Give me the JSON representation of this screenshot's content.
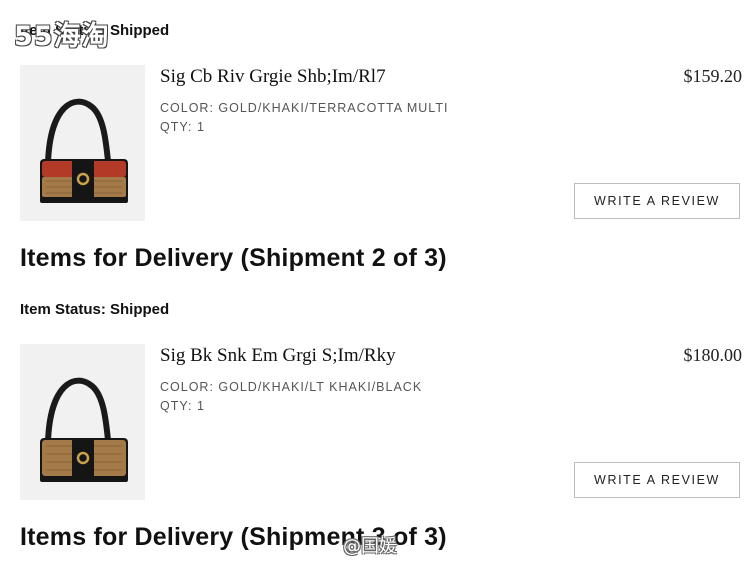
{
  "watermark_top": "55海淘",
  "watermark_bottom": "@国媛",
  "shipment1": {
    "status": "Item Status: Shipped",
    "item": {
      "name": "Sig Cb Riv Grgie Shb;Im/Rl7",
      "price": "$159.20",
      "color": "COLOR: GOLD/KHAKI/TERRACOTTA MULTI",
      "qty": "QTY: 1",
      "review_label": "WRITE A REVIEW",
      "image_icon": "handbag-terracotta"
    }
  },
  "shipment2": {
    "heading": "Items for Delivery (Shipment 2 of 3)",
    "status": "Item Status: Shipped",
    "item": {
      "name": "Sig Bk Snk Em Grgi S;Im/Rky",
      "price": "$180.00",
      "color": "COLOR: GOLD/KHAKI/LT KHAKI/BLACK",
      "qty": "QTY: 1",
      "review_label": "WRITE A REVIEW",
      "image_icon": "handbag-khaki-black"
    }
  },
  "shipment3": {
    "heading": "Items for Delivery (Shipment 3 of 3)"
  },
  "colors": {
    "terracotta": "#b33a26",
    "khaki": "#a37a48",
    "black": "#151515",
    "gold": "#c9a24a"
  }
}
